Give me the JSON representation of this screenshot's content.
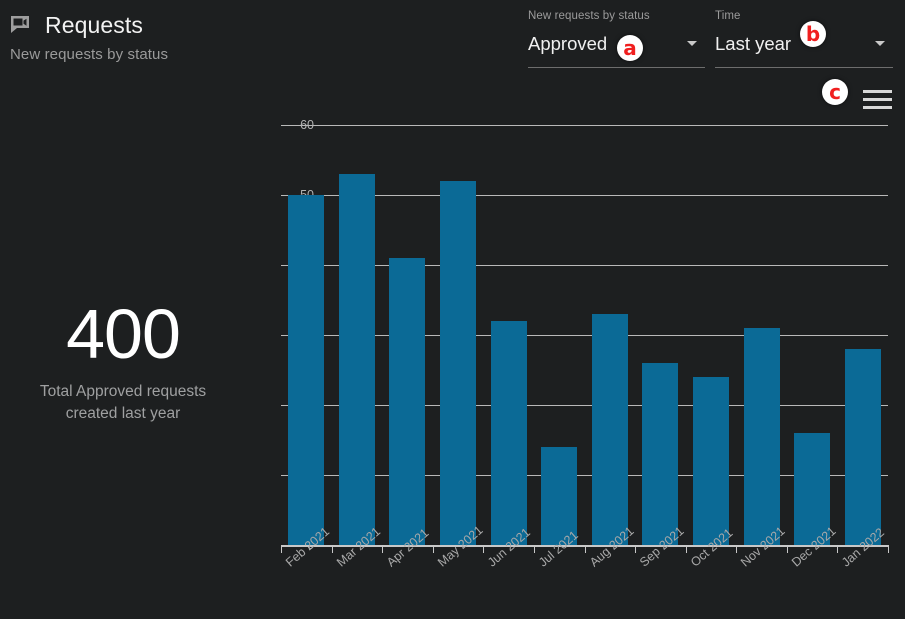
{
  "header": {
    "icon": "video-chat-bubble-icon",
    "title": "Requests",
    "subtitle": "New requests by status"
  },
  "controls": {
    "status_select": {
      "label": "New requests by status",
      "value": "Approved",
      "arrow_icon": "chevron-down-icon"
    },
    "time_select": {
      "label": "Time",
      "value": "Last year",
      "arrow_icon": "chevron-down-icon"
    },
    "menu_button": {
      "icon": "hamburger-menu-icon"
    }
  },
  "annotations": [
    {
      "id": "a",
      "label": "a"
    },
    {
      "id": "b",
      "label": "b"
    },
    {
      "id": "c",
      "label": "c"
    }
  ],
  "metric": {
    "value": "400",
    "caption": "Total Approved requests created last year"
  },
  "colors": {
    "background": "#1d1f20",
    "bar": "#0b6a96",
    "gridline": "#b9b9b9",
    "axis_text": "#a9a9a9",
    "marker_red": "#f01f1f"
  },
  "chart_data": {
    "type": "bar",
    "title": "",
    "subtitle": "",
    "xlabel": "",
    "ylabel": "",
    "categories": [
      "Feb 2021",
      "Mar 2021",
      "Apr 2021",
      "May 2021",
      "Jun 2021",
      "Jul 2021",
      "Aug 2021",
      "Sep 2021",
      "Oct 2021",
      "Nov 2021",
      "Dec 2021",
      "Jan 2022"
    ],
    "values": [
      50,
      53,
      41,
      52,
      32,
      14,
      33,
      26,
      24,
      31,
      16,
      28
    ],
    "ylim": [
      0,
      60
    ],
    "yticks": [
      0,
      10,
      20,
      30,
      40,
      50,
      60
    ],
    "grid": true,
    "legend": "none",
    "series_color": "#0b6a96"
  }
}
